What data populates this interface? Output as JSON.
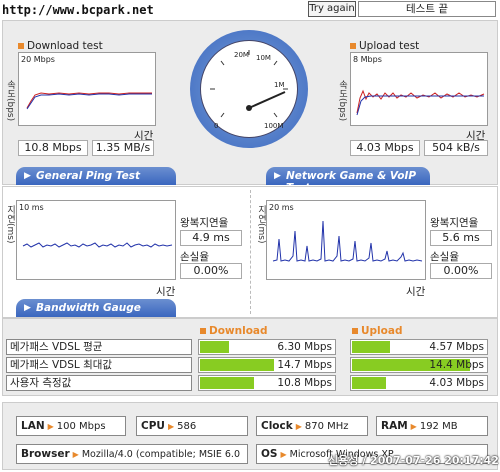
{
  "header": {
    "url": "http://www.bcpark.net",
    "try_again_label": "Try again",
    "status_label": "테스트 끝"
  },
  "download": {
    "title": "Download test",
    "axis_top": "20 Mbps",
    "ylabel": "속도(bps)",
    "xlabel": "시간",
    "speed_mbps": "10.8 Mbps",
    "speed_mbs": "1.35 MB/s"
  },
  "upload": {
    "title": "Upload test",
    "axis_top": "8 Mbps",
    "ylabel": "속도(bps)",
    "xlabel": "시간",
    "speed_mbps": "4.03 Mbps",
    "speed_kbs": "504 kB/s"
  },
  "gauge": {
    "labels": [
      "20M",
      "1M",
      "0",
      "100M",
      "10M"
    ]
  },
  "ping": {
    "tab_label": "General Ping Test",
    "axis_top": "10 ms",
    "ylabel": "지연(ms)",
    "xlabel": "시간",
    "rtt_label": "왕복지연율",
    "rtt_value": "4.9 ms",
    "loss_label": "손실율",
    "loss_value": "0.00%"
  },
  "game": {
    "tab_label": "Network Game & VoIP Test",
    "axis_top": "20 ms",
    "ylabel": "지연(ms)",
    "xlabel": "시간",
    "rtt_label": "왕복지연율",
    "rtt_value": "5.6 ms",
    "loss_label": "손실율",
    "loss_value": "0.00%"
  },
  "bandwidth": {
    "tab_label": "Bandwidth Gauge",
    "download_header": "Download",
    "upload_header": "Upload",
    "rows": [
      {
        "label": "메가패스 VDSL 평균",
        "down": "6.30 Mbps",
        "down_frac": 0.22,
        "up": "4.57 Mbps",
        "up_frac": 0.28
      },
      {
        "label": "메가패스 VDSL 최대값",
        "down": "14.7 Mbps",
        "down_frac": 0.55,
        "up": "14.4 Mbps",
        "up_frac": 0.88
      },
      {
        "label": "사용자 측정값",
        "down": "10.8 Mbps",
        "down_frac": 0.4,
        "up": "4.03 Mbps",
        "up_frac": 0.25
      }
    ]
  },
  "system": {
    "lan_label": "LAN",
    "lan_value": "100 Mbps",
    "cpu_label": "CPU",
    "cpu_value": "586",
    "clock_label": "Clock",
    "clock_value": "870 MHz",
    "ram_label": "RAM",
    "ram_value": "192 MB",
    "browser_label": "Browser",
    "browser_value": "Mozilla/4.0 (compatible; MSIE 6.0",
    "os_label": "OS",
    "os_value": "Microsoft Windows XP",
    "watermark": "신용성 / 2007-07-26 20:17:42"
  },
  "colors": {
    "accent_orange": "#e8892c",
    "bar_green": "#88cc22",
    "tab_blue": "#3a66bf"
  }
}
